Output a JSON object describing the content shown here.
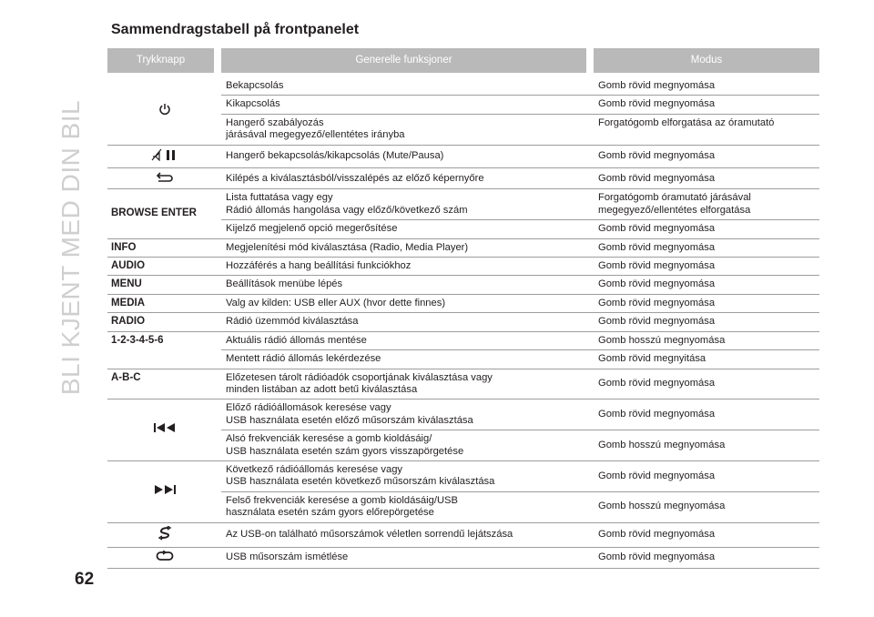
{
  "sidebar": {
    "title": "BLI KJENT MED DIN BIL"
  },
  "page_number": "62",
  "section_title": "Sammendragstabell på frontpanelet",
  "table": {
    "headers": {
      "button": "Trykknapp",
      "functions": "Generelle funksjoner",
      "mode": "Modus"
    },
    "rows": [
      {
        "key": "",
        "key_icon": "power-icon",
        "func": [
          "Bekapcsolás"
        ],
        "mode": [
          "Gomb rövid megnyomása"
        ]
      },
      {
        "func": [
          "Kikapcsolás"
        ],
        "mode": [
          "Gomb rövid megnyomása"
        ]
      },
      {
        "func": [
          "Hangerő szabályozás",
          "járásával megegyező/ellentétes irányba"
        ],
        "mode": [
          "Forgatógomb elforgatása az óramutató"
        ]
      },
      {
        "key": "",
        "key_icon": "mute-pause-icon",
        "func": [
          "Hangerő bekapcsolás/kikapcsolás (Mute/Pausa)"
        ],
        "mode": [
          "Gomb rövid megnyomása"
        ]
      },
      {
        "key": "",
        "key_icon": "back-arrow-icon",
        "func": [
          "Kilépés a kiválasztásból/visszalépés az előző képernyőre"
        ],
        "mode": [
          "Gomb rövid megnyomása"
        ]
      },
      {
        "key": "BROWSE ENTER",
        "func": [
          "Lista futtatása vagy egy",
          "Rádió állomás hangolása vagy előző/következő szám"
        ],
        "mode": [
          "Forgatógomb óramutató járásával",
          "megegyező/ellentétes elforgatása"
        ]
      },
      {
        "func": [
          "Kijelző megjelenő opció megerősítése"
        ],
        "mode": [
          "Gomb rövid megnyomása"
        ]
      },
      {
        "key": "INFO",
        "func": [
          "Megjelenítési mód kiválasztása (Radio, Media Player)"
        ],
        "mode": [
          "Gomb rövid megnyomása"
        ]
      },
      {
        "key": "AUDIO",
        "func": [
          "Hozzáférés a hang beállítási funkciókhoz"
        ],
        "mode": [
          "Gomb rövid megnyomása"
        ]
      },
      {
        "key": "MENU",
        "func": [
          "Beállítások menübe lépés"
        ],
        "mode": [
          "Gomb rövid megnyomása"
        ]
      },
      {
        "key": "MEDIA",
        "func": [
          "Valg av kilden: USB eller AUX (hvor dette finnes)"
        ],
        "mode": [
          "Gomb rövid megnyomása"
        ]
      },
      {
        "key": "RADIO",
        "func": [
          "Rádió üzemmód kiválasztása"
        ],
        "mode": [
          "Gomb rövid megnyomása"
        ]
      },
      {
        "key": "1-2-3-4-5-6",
        "func": [
          "Aktuális rádió állomás mentése"
        ],
        "mode": [
          "Gomb hosszú megnyomása"
        ]
      },
      {
        "func": [
          "Mentett rádió állomás lekérdezése"
        ],
        "mode": [
          "Gomb rövid megnyitása"
        ]
      },
      {
        "key": "A-B-C",
        "func": [
          "Előzetesen tárolt rádióadók csoportjának kiválasztása vagy",
          "minden listában az adott betű kiválasztása"
        ],
        "mode": [
          "Gomb rövid megnyomása"
        ]
      },
      {
        "key": "",
        "key_icon": "previous-track-icon",
        "func": [
          "Előző rádióállomások keresése vagy",
          "USB használata esetén előző műsorszám kiválasztása"
        ],
        "mode": [
          "Gomb rövid megnyomása"
        ]
      },
      {
        "func": [
          "Alsó frekvenciák keresése a gomb kioldásáig/",
          "USB használata esetén szám gyors visszapörgetése"
        ],
        "mode": [
          "Gomb hosszú megnyomása"
        ]
      },
      {
        "key": "",
        "key_icon": "next-track-icon",
        "func": [
          "Következő rádióállomás keresése vagy",
          "USB használata esetén következő műsorszám kiválasztása"
        ],
        "mode": [
          "Gomb rövid megnyomása"
        ]
      },
      {
        "func": [
          "Felső frekvenciák keresése a gomb kioldásáig/USB",
          "használata esetén szám gyors előrepörgetése"
        ],
        "mode": [
          "Gomb hosszú megnyomása"
        ]
      },
      {
        "key": "",
        "key_icon": "shuffle-icon",
        "func": [
          "Az USB-on található műsorszámok véletlen sorrendű lejátszása"
        ],
        "mode": [
          "Gomb rövid megnyomása"
        ]
      },
      {
        "key": "",
        "key_icon": "repeat-icon",
        "func": [
          "USB műsorszám ismétlése"
        ],
        "mode": [
          "Gomb rövid megnyomása"
        ]
      }
    ]
  }
}
